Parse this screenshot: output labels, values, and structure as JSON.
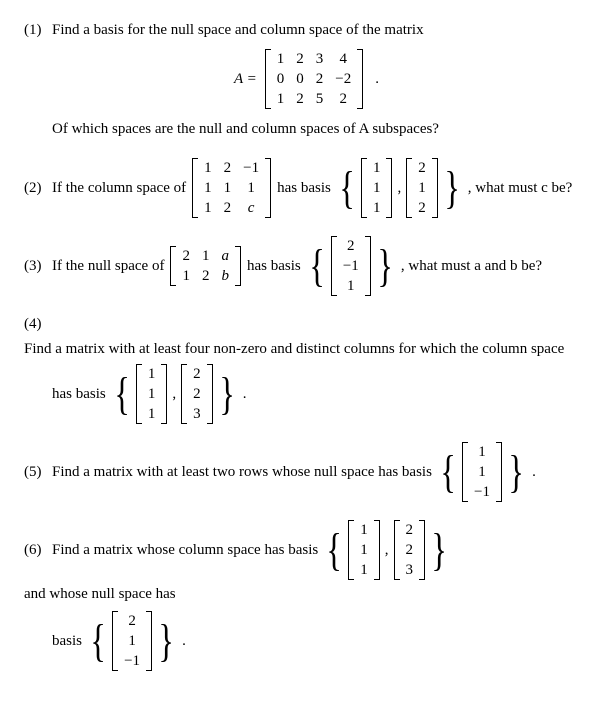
{
  "p1": {
    "num": "(1)",
    "text1": "Find a basis for the null space and column space of the matrix",
    "Aeq": "A =",
    "A": [
      [
        "1",
        "2",
        "3",
        "4"
      ],
      [
        "0",
        "0",
        "2",
        "−2"
      ],
      [
        "1",
        "2",
        "5",
        "2"
      ]
    ],
    "text2": "Of which spaces are the null and column spaces of A subspaces?"
  },
  "p2": {
    "num": "(2)",
    "t1": "If the column space of",
    "M": [
      [
        "1",
        "2",
        "−1"
      ],
      [
        "1",
        "1",
        "1"
      ],
      [
        "1",
        "2",
        "c"
      ]
    ],
    "t2": "has basis",
    "v1": [
      [
        "1"
      ],
      [
        "1"
      ],
      [
        "1"
      ]
    ],
    "v2": [
      [
        "2"
      ],
      [
        "1"
      ],
      [
        "2"
      ]
    ],
    "comma": ",",
    "t3": ", what must c be?"
  },
  "p3": {
    "num": "(3)",
    "t1": "If the null space of",
    "M": [
      [
        "2",
        "1",
        "a"
      ],
      [
        "1",
        "2",
        "b"
      ]
    ],
    "t2": "has basis",
    "v1": [
      [
        "2"
      ],
      [
        "−1"
      ],
      [
        "1"
      ]
    ],
    "t3": ", what must a and b be?"
  },
  "p4": {
    "num": "(4)",
    "t1": "Find a matrix with at least four non-zero and distinct columns for which the column space",
    "t2": "has basis",
    "v1": [
      [
        "1"
      ],
      [
        "1"
      ],
      [
        "1"
      ]
    ],
    "v2": [
      [
        "2"
      ],
      [
        "2"
      ],
      [
        "3"
      ]
    ],
    "comma": ",",
    "dot": "."
  },
  "p5": {
    "num": "(5)",
    "t1": "Find a matrix with at least two rows whose null space has basis",
    "v1": [
      [
        "1"
      ],
      [
        "1"
      ],
      [
        "−1"
      ]
    ],
    "dot": "."
  },
  "p6": {
    "num": "(6)",
    "t1": "Find a matrix whose column space has basis",
    "v1": [
      [
        "1"
      ],
      [
        "1"
      ],
      [
        "1"
      ]
    ],
    "v2": [
      [
        "2"
      ],
      [
        "2"
      ],
      [
        "3"
      ]
    ],
    "comma": ",",
    "t2": "and whose null space has",
    "t3": "basis",
    "v3": [
      [
        "2"
      ],
      [
        "1"
      ],
      [
        "−1"
      ]
    ],
    "dot": "."
  }
}
